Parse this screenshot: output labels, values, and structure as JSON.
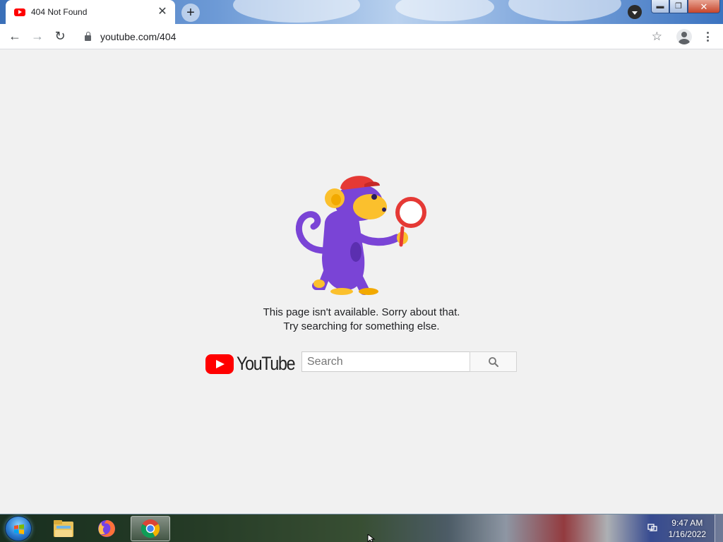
{
  "browser": {
    "tab": {
      "title": "404 Not Found",
      "close_glyph": "✕"
    },
    "new_tab_glyph": "+",
    "window_controls": {
      "minimize": "▬",
      "maximize": "❐",
      "close": "✕"
    },
    "toolbar": {
      "back_glyph": "←",
      "forward_glyph": "→",
      "reload_glyph": "↻",
      "url": "youtube.com/404",
      "bookmark_glyph": "☆"
    }
  },
  "page": {
    "illustration": "monkey-with-magnifying-glass",
    "message_line1": "This page isn't available. Sorry about that.",
    "message_line2": "Try searching for something else.",
    "logo_text": "YouTube",
    "search": {
      "placeholder": "Search",
      "value": ""
    }
  },
  "colors": {
    "youtube_red": "#ff0000",
    "page_background": "#f1f1f1",
    "monkey_purple": "#7a44d6",
    "monkey_yellow": "#fbc02d",
    "hat_red": "#e53935"
  },
  "taskbar": {
    "pinned": [
      "windows-explorer",
      "firefox",
      "chrome"
    ],
    "active": "chrome",
    "time": "9:47 AM",
    "date": "1/16/2022"
  }
}
